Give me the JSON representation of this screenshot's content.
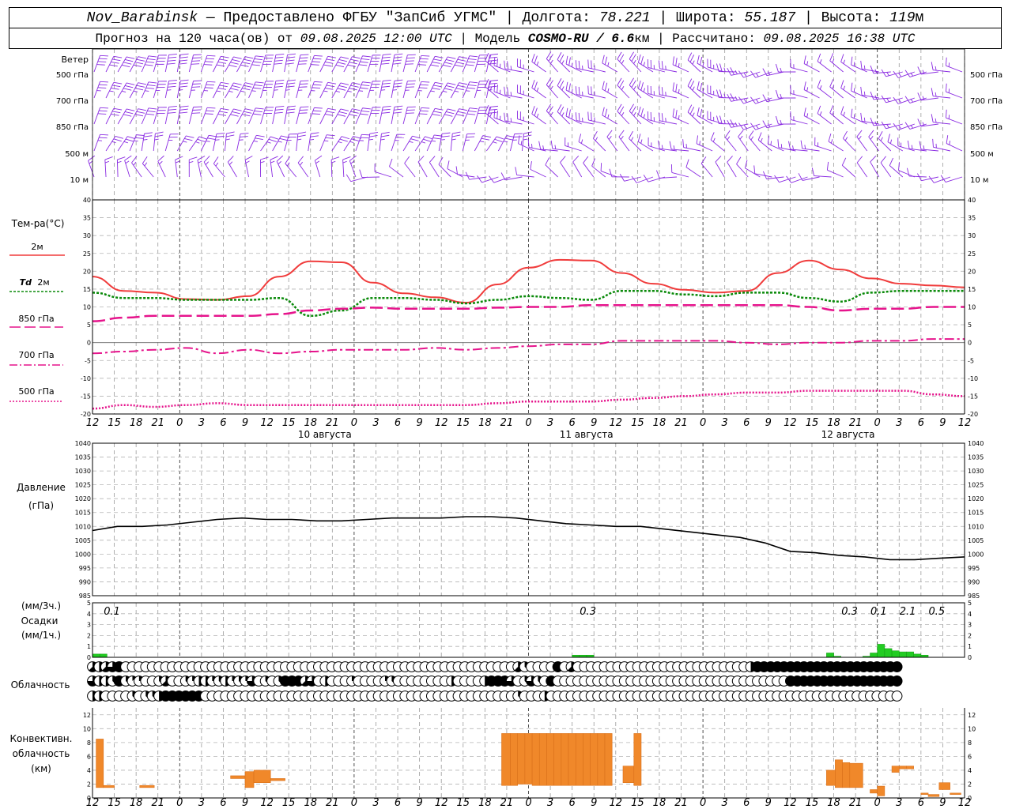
{
  "header": {
    "station": "Nov_Barabinsk",
    "dash": " — ",
    "provider": "Предоставлено ФГБУ \"ЗапСиб УГМС\"",
    "lon_label": "Долгота:",
    "lon_value": "78.221",
    "lat_label": "Широта:",
    "lat_value": "55.187",
    "alt_label": "Высота:",
    "alt_value": "119",
    "alt_unit": "м",
    "sep": " | ",
    "forecast_label": "Прогноз на 120 часа(ов) от",
    "forecast_time": "09.08.2025 12:00 UTC",
    "model_label": "Модель",
    "model_name": "COSMO-RU / 6.6",
    "model_unit": "км",
    "calc_label": "Рассчитано:",
    "calc_time": "09.08.2025 16:38 UTC"
  },
  "labels": {
    "wind": "Ветер",
    "wind_levels": [
      "500 гПа",
      "700 гПа",
      "850 гПа",
      "500  м",
      "10  м"
    ],
    "temp_title": "Тем-ра(°C)",
    "legend_2m": "2м",
    "legend_td_symbol": "Td",
    "legend_td": "2м",
    "legend_850": "850 гПа",
    "legend_700": "700 гПа",
    "legend_500": "500 гПа",
    "pressure_title": "Давление",
    "pressure_unit": "(гПа)",
    "precip_unit_3h": "(мм/3ч.)",
    "precip_title": "Осадки",
    "precip_unit_1h": "(мм/1ч.)",
    "cloud_title": "Облачность",
    "conv_title_1": "Конвективн.",
    "conv_title_2": "облачность",
    "conv_unit": "(км)"
  },
  "colors": {
    "t2m": "#f03c3c",
    "td": "#0a8a0a",
    "t850": "#e6148c",
    "t700": "#e6148c",
    "t500": "#e6148c",
    "wind": "#8a2be2",
    "pressure": "#000000",
    "precip": "#22cc22",
    "convective": "#f0882a"
  },
  "chart_data": [
    {
      "type": "line",
      "name": "temperature",
      "x_hours": [
        0,
        3,
        6,
        9,
        12,
        15,
        18,
        21,
        24,
        27,
        30,
        33,
        36,
        39,
        42,
        45,
        48,
        51,
        54,
        57,
        60,
        63,
        66,
        69,
        72,
        75,
        78,
        81,
        84,
        87,
        90,
        93,
        96,
        99,
        102,
        105,
        108,
        111,
        114,
        117,
        120
      ],
      "xticks": [
        "12",
        "15",
        "18",
        "21",
        "0",
        "3",
        "6",
        "9",
        "12",
        "15",
        "18",
        "21",
        "0",
        "3",
        "6",
        "9",
        "12",
        "15",
        "18",
        "21",
        "0",
        "3",
        "6",
        "9",
        "12",
        "15",
        "18",
        "21",
        "0",
        "3",
        "6",
        "9",
        "12",
        "15",
        "18",
        "21",
        "0",
        "3",
        "6",
        "9",
        "12"
      ],
      "ylim": [
        -20,
        40
      ],
      "yticks": [
        40,
        35,
        30,
        25,
        20,
        15,
        10,
        5,
        0,
        -5,
        -10,
        -15,
        -20
      ],
      "dates": [
        "10 августа",
        "11 августа",
        "12 августа"
      ],
      "series": [
        {
          "key": "t2m",
          "values": [
            18.5,
            14.5,
            14,
            12.2,
            12,
            13,
            18.5,
            22.8,
            22.5,
            16.8,
            13.8,
            12.7,
            11.2,
            16.3,
            21,
            23.2,
            23,
            19.5,
            16.5,
            14.8,
            14,
            14.5,
            19.5,
            23,
            20.5,
            18,
            16.5,
            16,
            15.5
          ]
        },
        {
          "key": "td",
          "values": [
            14,
            12.5,
            12.5,
            12,
            12,
            12,
            12.5,
            7.5,
            9,
            12.5,
            12.5,
            12,
            11,
            12,
            13,
            12.5,
            12,
            14.5,
            14.5,
            13.5,
            13,
            14,
            14,
            12.5,
            11.5,
            14,
            14.5,
            14.5,
            14.5
          ]
        },
        {
          "key": "t850",
          "values": [
            6,
            7,
            7.5,
            7.5,
            7.5,
            7.5,
            8,
            9,
            9.5,
            9.8,
            9.5,
            9.5,
            9.5,
            9.8,
            10,
            10,
            10.5,
            10.5,
            10.5,
            10.5,
            10.5,
            10.5,
            10.5,
            10,
            9,
            9.5,
            9.5,
            10,
            10
          ]
        },
        {
          "key": "t700",
          "values": [
            -3,
            -2.5,
            -2,
            -1.5,
            -3,
            -2,
            -3,
            -2.5,
            -2,
            -2,
            -2,
            -1.5,
            -2,
            -1.5,
            -1,
            -0.5,
            -0.5,
            0.5,
            0.5,
            0.5,
            0.5,
            0,
            -0.5,
            0,
            0,
            0.5,
            0.5,
            1,
            1
          ]
        },
        {
          "key": "t500",
          "values": [
            -18.5,
            -17.5,
            -18,
            -17.5,
            -17,
            -17.5,
            -17.5,
            -17.5,
            -17.5,
            -17.5,
            -17.5,
            -17.5,
            -17.5,
            -17,
            -16.5,
            -16.5,
            -16.5,
            -16,
            -15.5,
            -15,
            -14.5,
            -14,
            -14,
            -13.5,
            -13.5,
            -13.5,
            -13.5,
            -14.5,
            -15
          ]
        }
      ],
      "series_x_step_hours": 4.3
    },
    {
      "type": "line",
      "name": "pressure",
      "ylim": [
        985,
        1040
      ],
      "yticks": [
        1040,
        1035,
        1030,
        1025,
        1020,
        1015,
        1010,
        1005,
        1000,
        995,
        990,
        985
      ],
      "x_hours": [
        0,
        3,
        6,
        9,
        12,
        15,
        18,
        21,
        24,
        27,
        30,
        33,
        36,
        39,
        42,
        45,
        48,
        51,
        54,
        57,
        60,
        63,
        66,
        69,
        72,
        75,
        78,
        81,
        84,
        87,
        90,
        93,
        96,
        99,
        102,
        105,
        108,
        111,
        114,
        117,
        120
      ],
      "values": [
        1008.5,
        1010,
        1010,
        1010.5,
        1011.5,
        1012.5,
        1013,
        1012.5,
        1012.5,
        1012,
        1012,
        1012.5,
        1013,
        1013,
        1013,
        1013.5,
        1013.5,
        1013,
        1012,
        1011,
        1010.5,
        1010,
        1010,
        1009,
        1008,
        1007,
        1006,
        1004,
        1001,
        1000.5,
        999.5,
        999,
        998,
        998,
        998.5,
        999
      ]
    },
    {
      "type": "bar",
      "name": "precipitation",
      "ylim": [
        0,
        5
      ],
      "yticks": [
        5,
        4,
        3,
        2,
        1,
        0
      ],
      "totals_3h": [
        {
          "hour": 0.5,
          "text": "0.1"
        },
        {
          "hour": 66,
          "text": "0.3"
        },
        {
          "hour": 102,
          "text": "0.3"
        },
        {
          "hour": 106,
          "text": "0.1"
        },
        {
          "hour": 110,
          "text": "2.1"
        },
        {
          "hour": 114,
          "text": "0.5"
        }
      ],
      "bars_1h": [
        [
          0,
          0.3
        ],
        [
          1,
          0.3
        ],
        [
          66,
          0.2
        ],
        [
          67,
          0.2
        ],
        [
          68,
          0.2
        ],
        [
          101,
          0.4
        ],
        [
          102,
          0.1
        ],
        [
          106,
          0.1
        ],
        [
          107,
          0.4
        ],
        [
          108,
          1.2
        ],
        [
          109,
          0.8
        ],
        [
          110,
          0.6
        ],
        [
          111,
          0.5
        ],
        [
          112,
          0.5
        ],
        [
          113,
          0.3
        ],
        [
          114,
          0.2
        ]
      ]
    },
    {
      "type": "table",
      "name": "cloudiness",
      "symbol_legend": [
        "0 = clear",
        "1-3 = partial",
        "4 = half",
        "5-7 = mostly",
        "8 = overcast"
      ],
      "rows": {
        "high": [
          5,
          4,
          5,
          6,
          8,
          0,
          0,
          0,
          0,
          0,
          0,
          0,
          0,
          0,
          0,
          0,
          0,
          0,
          0,
          0,
          0,
          0,
          0,
          0,
          0,
          0,
          0,
          0,
          0,
          0,
          0,
          0,
          0,
          0,
          0,
          0,
          0,
          0,
          0,
          0,
          0,
          0,
          0,
          0,
          0,
          0,
          0,
          0,
          0,
          0,
          0,
          0,
          0,
          0,
          0,
          0,
          0,
          0,
          0,
          0,
          0,
          0,
          0,
          0,
          5,
          3,
          0,
          0,
          0,
          0,
          8,
          0,
          5,
          0,
          0,
          0,
          0,
          0,
          0,
          0,
          0,
          0,
          0,
          0,
          0,
          0,
          0,
          0,
          0,
          0,
          0,
          0,
          0,
          0,
          0,
          0,
          0,
          0,
          0,
          4,
          8,
          8,
          8,
          8,
          8,
          8,
          8,
          8,
          8,
          8,
          8,
          8,
          8,
          8,
          8,
          8,
          8,
          8,
          8,
          8,
          8,
          8,
          8,
          8,
          8,
          8,
          8,
          4,
          6,
          8,
          8,
          4,
          0
        ],
        "middle": [
          6,
          4,
          4,
          3,
          8,
          3,
          1,
          2,
          0,
          0,
          3,
          5,
          0,
          0,
          3,
          2,
          4,
          4,
          2,
          3,
          4,
          2,
          3,
          2,
          6,
          0,
          3,
          0,
          3,
          8,
          8,
          8,
          5,
          6,
          0,
          4,
          0,
          0,
          0,
          2,
          0,
          0,
          0,
          0,
          2,
          3,
          0,
          0,
          0,
          0,
          0,
          0,
          0,
          0,
          4,
          0,
          0,
          0,
          0,
          4,
          8,
          8,
          8,
          6,
          0,
          3,
          6,
          3,
          0,
          8,
          0,
          0,
          0,
          0,
          0,
          0,
          0,
          0,
          0,
          0,
          0,
          0,
          0,
          0,
          0,
          0,
          0,
          0,
          0,
          0,
          0,
          0,
          0,
          0,
          0,
          0,
          0,
          0,
          0,
          0,
          0,
          0,
          0,
          0,
          0,
          8,
          8,
          8,
          8,
          8,
          8,
          8,
          8,
          8,
          8,
          8,
          8,
          8,
          8,
          8,
          8,
          8,
          8,
          8,
          8,
          8,
          8,
          6,
          6,
          0
        ],
        "low": [
          4,
          4,
          0,
          0,
          0,
          0,
          3,
          0,
          3,
          3,
          4,
          8,
          8,
          8,
          8,
          8,
          8,
          0,
          0,
          0,
          0,
          0,
          0,
          0,
          0,
          0,
          0,
          0,
          0,
          0,
          0,
          0,
          0,
          0,
          0,
          0,
          0,
          0,
          0,
          0,
          0,
          0,
          0,
          0,
          0,
          0,
          0,
          0,
          0,
          0,
          0,
          0,
          0,
          0,
          0,
          0,
          0,
          0,
          0,
          0,
          0,
          0,
          0,
          0,
          3,
          0,
          0,
          0,
          4,
          0,
          0,
          0,
          0,
          0,
          0,
          0,
          0,
          0,
          0,
          0,
          0,
          0,
          0,
          0,
          0,
          0,
          0,
          0,
          0,
          0,
          0,
          0,
          0,
          0,
          0,
          0,
          0,
          0,
          0,
          0,
          0,
          0,
          0,
          0,
          0,
          0,
          0,
          0,
          0,
          0,
          0,
          0,
          0,
          0,
          0,
          0,
          0,
          0,
          0,
          0,
          0,
          0,
          0,
          0,
          0,
          0,
          0,
          0,
          0,
          4,
          8,
          8,
          4,
          0
        ]
      }
    },
    {
      "type": "bar",
      "name": "convective_cloud",
      "ylim": [
        0,
        13
      ],
      "yticks": [
        12,
        10,
        8,
        6,
        4,
        2,
        0
      ],
      "layers": [
        {
          "h0": 0.5,
          "h1": 1.5,
          "base": 1.5,
          "top": 8.5
        },
        {
          "h0": 1.5,
          "h1": 3,
          "base": 1.5,
          "top": 1.8
        },
        {
          "h0": 6.5,
          "h1": 8.5,
          "base": 1.5,
          "top": 1.8
        },
        {
          "h0": 19,
          "h1": 21,
          "base": 2.8,
          "top": 3.2
        },
        {
          "h0": 21,
          "h1": 22.2,
          "base": 1.5,
          "top": 3.8
        },
        {
          "h0": 22.2,
          "h1": 24.5,
          "base": 2.2,
          "top": 4
        },
        {
          "h0": 24.5,
          "h1": 26.5,
          "base": 2.5,
          "top": 2.8
        },
        {
          "h0": 56.3,
          "h1": 57.5,
          "base": 1.8,
          "top": 9.3
        },
        {
          "h0": 57.5,
          "h1": 58.5,
          "base": 1.8,
          "top": 9.3
        },
        {
          "h0": 58.5,
          "h1": 59.5,
          "base": 2,
          "top": 9.3
        },
        {
          "h0": 59.5,
          "h1": 60.5,
          "base": 2,
          "top": 9.3
        },
        {
          "h0": 60.5,
          "h1": 61.5,
          "base": 1.8,
          "top": 9.3
        },
        {
          "h0": 61.5,
          "h1": 62.5,
          "base": 1.8,
          "top": 9.3
        },
        {
          "h0": 62.5,
          "h1": 63.5,
          "base": 1.8,
          "top": 9.3
        },
        {
          "h0": 63.5,
          "h1": 64.5,
          "base": 1.8,
          "top": 9.3
        },
        {
          "h0": 64.5,
          "h1": 65.5,
          "base": 1.8,
          "top": 9.3
        },
        {
          "h0": 65.5,
          "h1": 66.5,
          "base": 1.8,
          "top": 9.3
        },
        {
          "h0": 66.5,
          "h1": 67.5,
          "base": 1.8,
          "top": 9.3
        },
        {
          "h0": 67.5,
          "h1": 68.5,
          "base": 1.8,
          "top": 9.3
        },
        {
          "h0": 68.5,
          "h1": 69.5,
          "base": 1.8,
          "top": 9.3
        },
        {
          "h0": 69.5,
          "h1": 70.5,
          "base": 1.8,
          "top": 9.3
        },
        {
          "h0": 70.5,
          "h1": 71.5,
          "base": 1.8,
          "top": 9.3
        },
        {
          "h0": 73,
          "h1": 74.5,
          "base": 2.2,
          "top": 4.6
        },
        {
          "h0": 74.5,
          "h1": 75.5,
          "base": 1.8,
          "top": 9.3
        },
        {
          "h0": 101,
          "h1": 102.2,
          "base": 1.8,
          "top": 4
        },
        {
          "h0": 102.2,
          "h1": 103.2,
          "base": 1.5,
          "top": 5.5
        },
        {
          "h0": 103.2,
          "h1": 104.2,
          "base": 1.5,
          "top": 5.1
        },
        {
          "h0": 104.2,
          "h1": 106,
          "base": 1.5,
          "top": 5
        },
        {
          "h0": 107,
          "h1": 108,
          "base": 0.7,
          "top": 1.2
        },
        {
          "h0": 108,
          "h1": 109,
          "base": 0.3,
          "top": 1.7
        },
        {
          "h0": 110,
          "h1": 111,
          "base": 3.7,
          "top": 4.6
        },
        {
          "h0": 111,
          "h1": 112,
          "base": 4.2,
          "top": 4.6
        },
        {
          "h0": 112,
          "h1": 113,
          "base": 4.2,
          "top": 4.6
        },
        {
          "h0": 114,
          "h1": 115,
          "base": 0.5,
          "top": 0.7
        },
        {
          "h0": 115,
          "h1": 116.5,
          "base": 0.2,
          "top": 0.5
        },
        {
          "h0": 116.5,
          "h1": 118,
          "base": 1.2,
          "top": 2.2
        },
        {
          "h0": 118,
          "h1": 119.5,
          "base": 0.5,
          "top": 0.7
        }
      ]
    }
  ]
}
